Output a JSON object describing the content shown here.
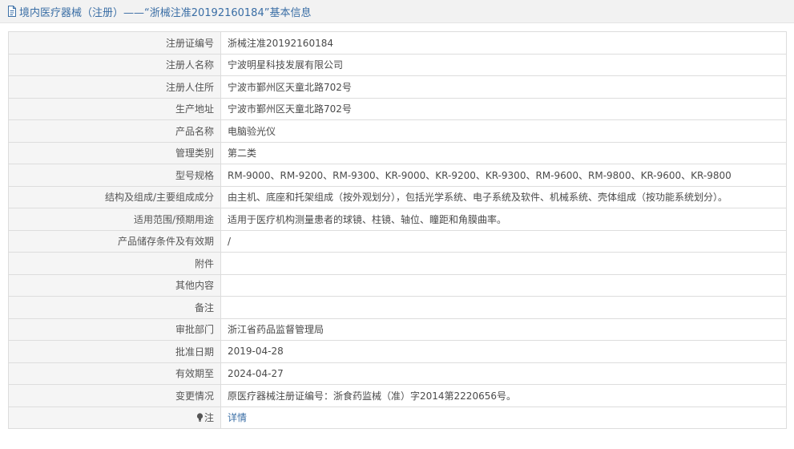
{
  "header": {
    "title": "境内医疗器械（注册）——“浙械注准20192160184”基本信息",
    "icon": "document-icon"
  },
  "colors": {
    "header_text": "#3a6ea5",
    "label_bg": "#f5f5f5",
    "border": "#dddddd",
    "link": "#3a6ea5"
  },
  "rows": [
    {
      "label": "注册证编号",
      "value": "浙械注准20192160184"
    },
    {
      "label": "注册人名称",
      "value": "宁波明星科技发展有限公司"
    },
    {
      "label": "注册人住所",
      "value": "宁波市鄞州区天童北路702号"
    },
    {
      "label": "生产地址",
      "value": "宁波市鄞州区天童北路702号"
    },
    {
      "label": "产品名称",
      "value": "电脑验光仪"
    },
    {
      "label": "管理类别",
      "value": "第二类"
    },
    {
      "label": "型号规格",
      "value": "RM-9000、RM-9200、RM-9300、KR-9000、KR-9200、KR-9300、RM-9600、RM-9800、KR-9600、KR-9800"
    },
    {
      "label": "结构及组成/主要组成成分",
      "value": "由主机、底座和托架组成（按外观划分），包括光学系统、电子系统及软件、机械系统、壳体组成（按功能系统划分）。"
    },
    {
      "label": "适用范围/预期用途",
      "value": "适用于医疗机构测量患者的球镜、柱镜、轴位、瞳距和角膜曲率。"
    },
    {
      "label": "产品储存条件及有效期",
      "value": "/"
    },
    {
      "label": "附件",
      "value": ""
    },
    {
      "label": "其他内容",
      "value": ""
    },
    {
      "label": "备注",
      "value": ""
    },
    {
      "label": "审批部门",
      "value": "浙江省药品监督管理局"
    },
    {
      "label": "批准日期",
      "value": "2019-04-28"
    },
    {
      "label": "有效期至",
      "value": "2024-04-27"
    },
    {
      "label": "变更情况",
      "value": "原医疗器械注册证编号：浙食药监械（准）字2014第2220656号。"
    }
  ],
  "note_row": {
    "label": "注",
    "icon": "lightbulb-icon",
    "link_text": "详情"
  }
}
